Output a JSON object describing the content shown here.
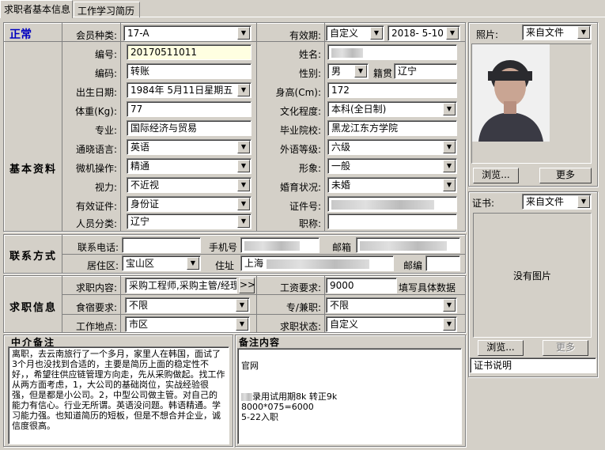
{
  "tabs": [
    "求职者基本信息",
    "工作学习简历"
  ],
  "status": "正常",
  "sections": {
    "basic": "基本资料",
    "contact": "联系方式",
    "job": "求职信息",
    "agent_note": "中介备注",
    "remarks": "备注内容"
  },
  "member_type": {
    "label": "会员种类:",
    "value": "17-A"
  },
  "validity": {
    "label": "有效期:",
    "mode": "自定义",
    "date": "2018- 5-10"
  },
  "fields": {
    "number": {
      "label": "编号:",
      "value": "20170511011"
    },
    "name": {
      "label": "姓名:"
    },
    "code": {
      "label": "编码:",
      "value": "转账"
    },
    "gender": {
      "label": "性别:",
      "value": "男"
    },
    "hometown": {
      "label": "籍贯",
      "value": "辽宁"
    },
    "birth": {
      "label": "出生日期:",
      "value": "1984年 5月11日星期五"
    },
    "height": {
      "label": "身高(Cm):",
      "value": "172"
    },
    "weight": {
      "label": "体重(Kg):",
      "value": "77"
    },
    "education": {
      "label": "文化程度:",
      "value": "本科(全日制)"
    },
    "major": {
      "label": "专业:",
      "value": "国际经济与贸易"
    },
    "school": {
      "label": "毕业院校:",
      "value": "黑龙江东方学院"
    },
    "language": {
      "label": "通晓语言:",
      "value": "英语"
    },
    "language_level": {
      "label": "外语等级:",
      "value": "六级"
    },
    "computer": {
      "label": "微机操作:",
      "value": "精通"
    },
    "appearance": {
      "label": "形象:",
      "value": "一般"
    },
    "vision": {
      "label": "视力:",
      "value": "不近视"
    },
    "marital": {
      "label": "婚育状况:",
      "value": "未婚"
    },
    "id_type": {
      "label": "有效证件:",
      "value": "身份证"
    },
    "id_number": {
      "label": "证件号:"
    },
    "person_type": {
      "label": "人员分类:",
      "value": "辽宁"
    },
    "title": {
      "label": "职称:",
      "value": ""
    }
  },
  "contact": {
    "phone_label": "联系电话:",
    "mobile_label": "手机号",
    "email_label": "邮箱",
    "district_label": "居住区:",
    "district_value": "宝山区",
    "address_label": "住址",
    "address_value": "上海",
    "zip_label": "邮编"
  },
  "job": {
    "content_label": "求职内容:",
    "content_value": "采购工程师,采购主管/经理",
    "more_btn": ">>",
    "salary_label": "工资要求:",
    "salary_value": "9000",
    "salary_hint": "填写具体数据",
    "housing_label": "食宿要求:",
    "housing_value": "不限",
    "parttime_label": "专/兼职:",
    "parttime_value": "不限",
    "location_label": "工作地点:",
    "location_value": "市区",
    "status_label": "求职状态:",
    "status_value": "自定义"
  },
  "agent_note_text": "离职，去云南旅行了一个多月，家里人在韩国，面试了3个月也没找到合适的，主要是简历上面的稳定性不好，，希望往供应链管理方向走，先从采购做起。找工作从两方面考虑，1，大公司的基础岗位，实战经验很强，但是都是小公司。2，中型公司做主管。对自己的能力有信心。行业无所谓。英语没问题。韩语精通。学习能力强。也知道简历的短板，但是不想合并企业，诚信度很高。",
  "remarks_lines": [
    "官网",
    "",
    "",
    "录用试用期8k 转正9k",
    "8000*075=6000",
    "5-22入职"
  ],
  "photo": {
    "label": "照片:",
    "source": "来自文件",
    "browse": "浏览...",
    "more": "更多"
  },
  "cert": {
    "label": "证书:",
    "source": "来自文件",
    "no_image": "没有图片",
    "browse": "浏览...",
    "more": "更多",
    "desc": "证书说明"
  }
}
